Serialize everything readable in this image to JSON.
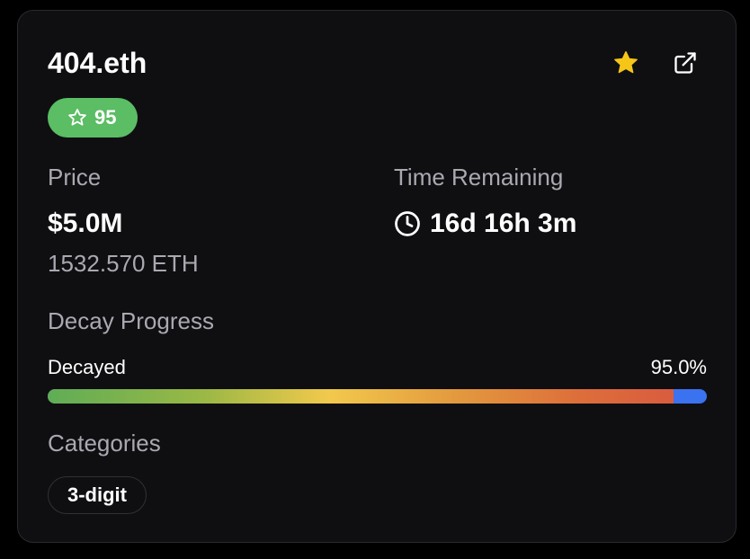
{
  "card": {
    "title": "404.eth",
    "score": "95",
    "price_label": "Price",
    "price_usd": "$5.0M",
    "price_eth": "1532.570 ETH",
    "time_label": "Time Remaining",
    "time_value": "16d 16h 3m",
    "decay_label": "Decay Progress",
    "decayed_label": "Decayed",
    "decay_percent_text": "95.0%",
    "decay_fraction": 0.95,
    "categories_label": "Categories",
    "categories": [
      "3-digit"
    ]
  },
  "icons": {
    "favorite": "star-filled-icon",
    "open": "external-link-icon",
    "score": "star-outline-icon",
    "clock": "clock-icon"
  },
  "colors": {
    "badge_green": "#5bbd64",
    "star_yellow": "#f5c518",
    "bar_blue": "#3b72f0",
    "card_bg": "#0f0f12"
  }
}
